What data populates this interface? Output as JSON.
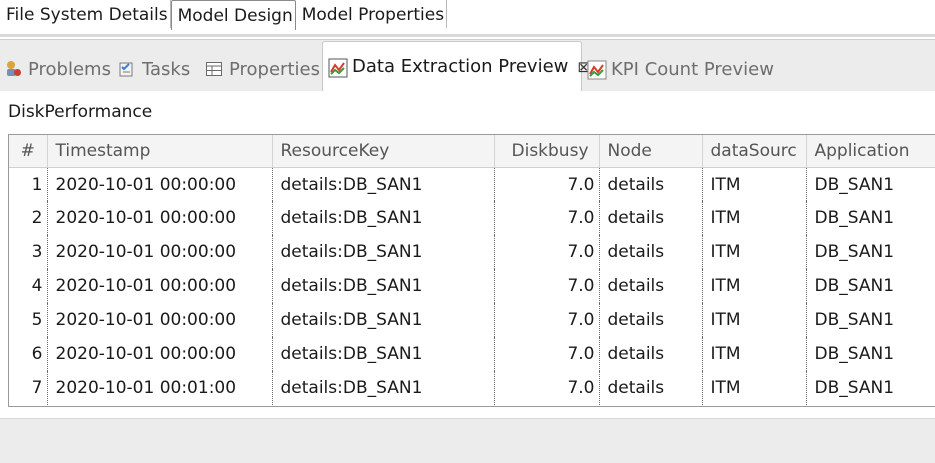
{
  "editor_tabs": [
    {
      "label": "File System Details",
      "active": false
    },
    {
      "label": "Model Design",
      "active": true
    },
    {
      "label": "Model Properties",
      "active": false
    }
  ],
  "view_tabs": {
    "problems": "Problems",
    "tasks": "Tasks",
    "properties": "Properties",
    "data_extraction": "Data Extraction Preview",
    "data_extraction_close": "⊠",
    "kpi_count": "KPI Count Preview"
  },
  "view": {
    "title": "DiskPerformance",
    "columns": [
      "#",
      "Timestamp",
      "ResourceKey",
      "Diskbusy",
      "Node",
      "dataSourc",
      "Application"
    ],
    "rows": [
      [
        "1",
        "2020-10-01 00:00:00",
        "details:DB_SAN1",
        "7.0",
        "details",
        "ITM",
        "DB_SAN1"
      ],
      [
        "2",
        "2020-10-01 00:00:00",
        "details:DB_SAN1",
        "7.0",
        "details",
        "ITM",
        "DB_SAN1"
      ],
      [
        "3",
        "2020-10-01 00:00:00",
        "details:DB_SAN1",
        "7.0",
        "details",
        "ITM",
        "DB_SAN1"
      ],
      [
        "4",
        "2020-10-01 00:00:00",
        "details:DB_SAN1",
        "7.0",
        "details",
        "ITM",
        "DB_SAN1"
      ],
      [
        "5",
        "2020-10-01 00:00:00",
        "details:DB_SAN1",
        "7.0",
        "details",
        "ITM",
        "DB_SAN1"
      ],
      [
        "6",
        "2020-10-01 00:00:00",
        "details:DB_SAN1",
        "7.0",
        "details",
        "ITM",
        "DB_SAN1"
      ],
      [
        "7",
        "2020-10-01 00:01:00",
        "details:DB_SAN1",
        "7.0",
        "details",
        "ITM",
        "DB_SAN1"
      ]
    ]
  },
  "icons": {
    "problems": "problems-icon",
    "tasks": "tasks-icon",
    "properties": "properties-icon",
    "data_extraction": "chart-icon",
    "kpi_count": "chart-icon"
  },
  "colors": {
    "chart_icon_red": "#d93a2b",
    "chart_icon_green": "#3c9a3c",
    "tab_bar_bg": "#ececec"
  }
}
